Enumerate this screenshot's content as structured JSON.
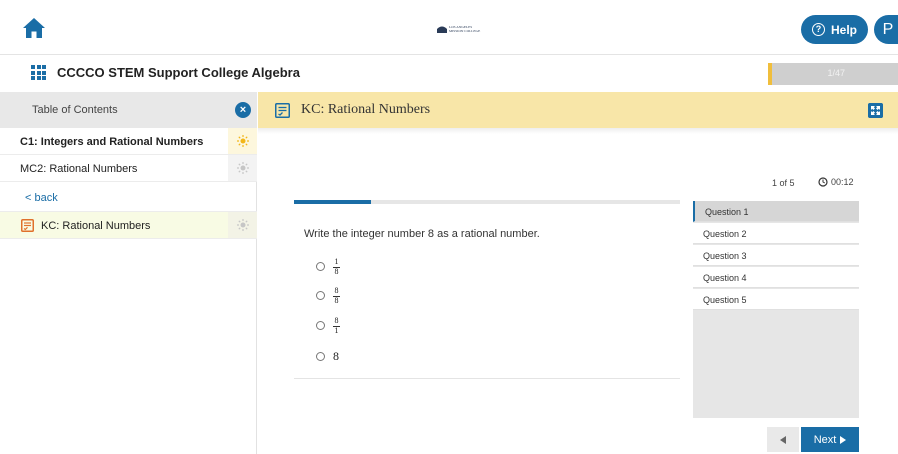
{
  "header": {
    "home_icon": "home-icon",
    "logo_lines": [
      "LOS ANGELES",
      "MISSION COLLEGE"
    ],
    "help_label": "Help",
    "profile_initial": "P"
  },
  "course": {
    "title": "CCCCO STEM Support College Algebra",
    "progress_text": "1/47",
    "progress_fraction": 0.03
  },
  "sidebar": {
    "title": "Table of Contents",
    "close_icon": "close-icon",
    "items": [
      {
        "label": "C1: Integers and Rational Numbers",
        "bold": true
      },
      {
        "label": "MC2: Rational Numbers",
        "bold": false
      }
    ],
    "back_label": "< back",
    "active_item": {
      "label": "KC: Rational Numbers"
    }
  },
  "main": {
    "title": "KC: Rational Numbers"
  },
  "quiz": {
    "count": "1 of 5",
    "timer": "00:12",
    "progress_fraction": 0.2,
    "question": "Write the integer number 8 as a rational number.",
    "options": [
      {
        "num": "1",
        "den": "8"
      },
      {
        "num": "8",
        "den": "8"
      },
      {
        "num": "8",
        "den": "1"
      },
      {
        "plain": "8"
      }
    ],
    "question_list": [
      "Question 1",
      "Question 2",
      "Question 3",
      "Question 4",
      "Question 5"
    ],
    "next_label": "Next"
  },
  "colors": {
    "accent": "#1a6da6",
    "header_yellow": "#f8e6a8",
    "progress_yellow": "#f0be3c"
  }
}
